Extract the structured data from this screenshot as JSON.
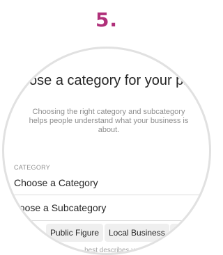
{
  "step": {
    "number": "5."
  },
  "profile_setup": {
    "title": "Choose a category for your profile",
    "description": "Choosing the right category and subcategory helps people understand what your business is about.",
    "section_label": "CATEGORY",
    "category_row": {
      "label": "Choose a Category",
      "icon": "chevron-right-icon"
    },
    "subcategory_row": {
      "label": "hoose a Subcategory"
    },
    "suggestions": [
      "",
      "Public Figure",
      "Local Business",
      "D"
    ],
    "hint": "best describes yo"
  },
  "colors": {
    "accent": "#b0307a",
    "text": "#262626",
    "secondary_text": "#8e8e8e",
    "chip_background": "#efefef",
    "lens_border": "#e1e1e1"
  }
}
